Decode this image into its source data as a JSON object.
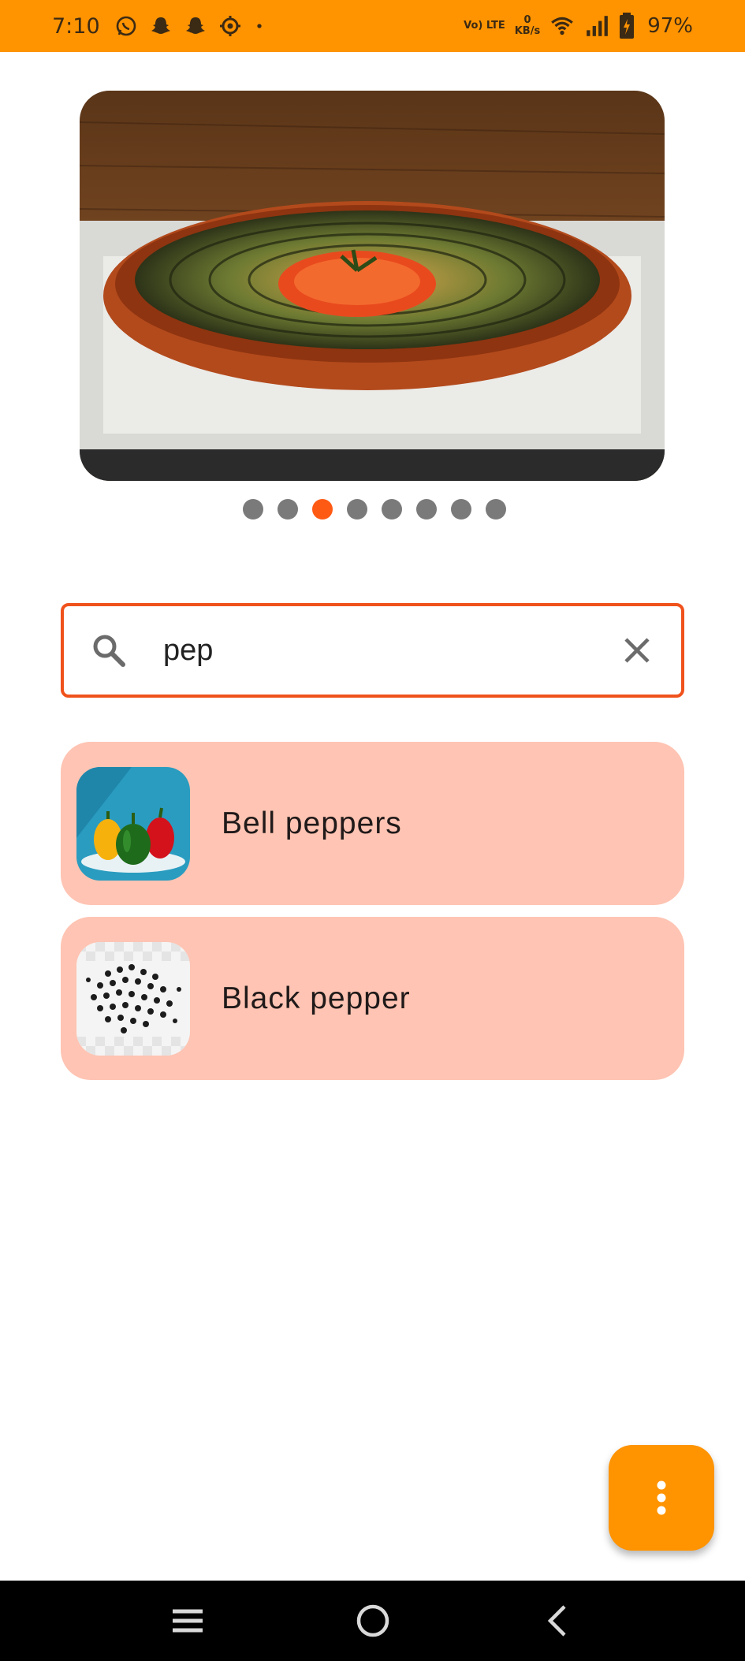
{
  "status_bar": {
    "time": "7:10",
    "network_type": "Vo) LTE",
    "data_rate_value": "0",
    "data_rate_unit": "KB/s",
    "battery": "97%",
    "icons": [
      "whatsapp-icon",
      "snapchat-icon",
      "snapchat-icon",
      "settings-icon",
      "dot-icon",
      "wifi-icon",
      "signal-icon",
      "battery-charging-icon"
    ]
  },
  "carousel": {
    "image": "ratatouille-dish-image",
    "page_count": 8,
    "active_index": 2
  },
  "search": {
    "value": "pep",
    "placeholder": ""
  },
  "results": [
    {
      "label": "Bell peppers",
      "image": "bell-peppers-image"
    },
    {
      "label": "Black pepper",
      "image": "black-pepper-image"
    }
  ],
  "fab": {
    "icon": "more-vert-icon"
  },
  "nav_bar": {
    "icons": [
      "menu-icon",
      "home-icon",
      "back-icon"
    ]
  },
  "colors": {
    "status_bar": "#ff9300",
    "accent": "#f0521c",
    "result_card": "#ffc4b3",
    "fab": "#ff9300",
    "dot_inactive": "#7a7a7a"
  }
}
